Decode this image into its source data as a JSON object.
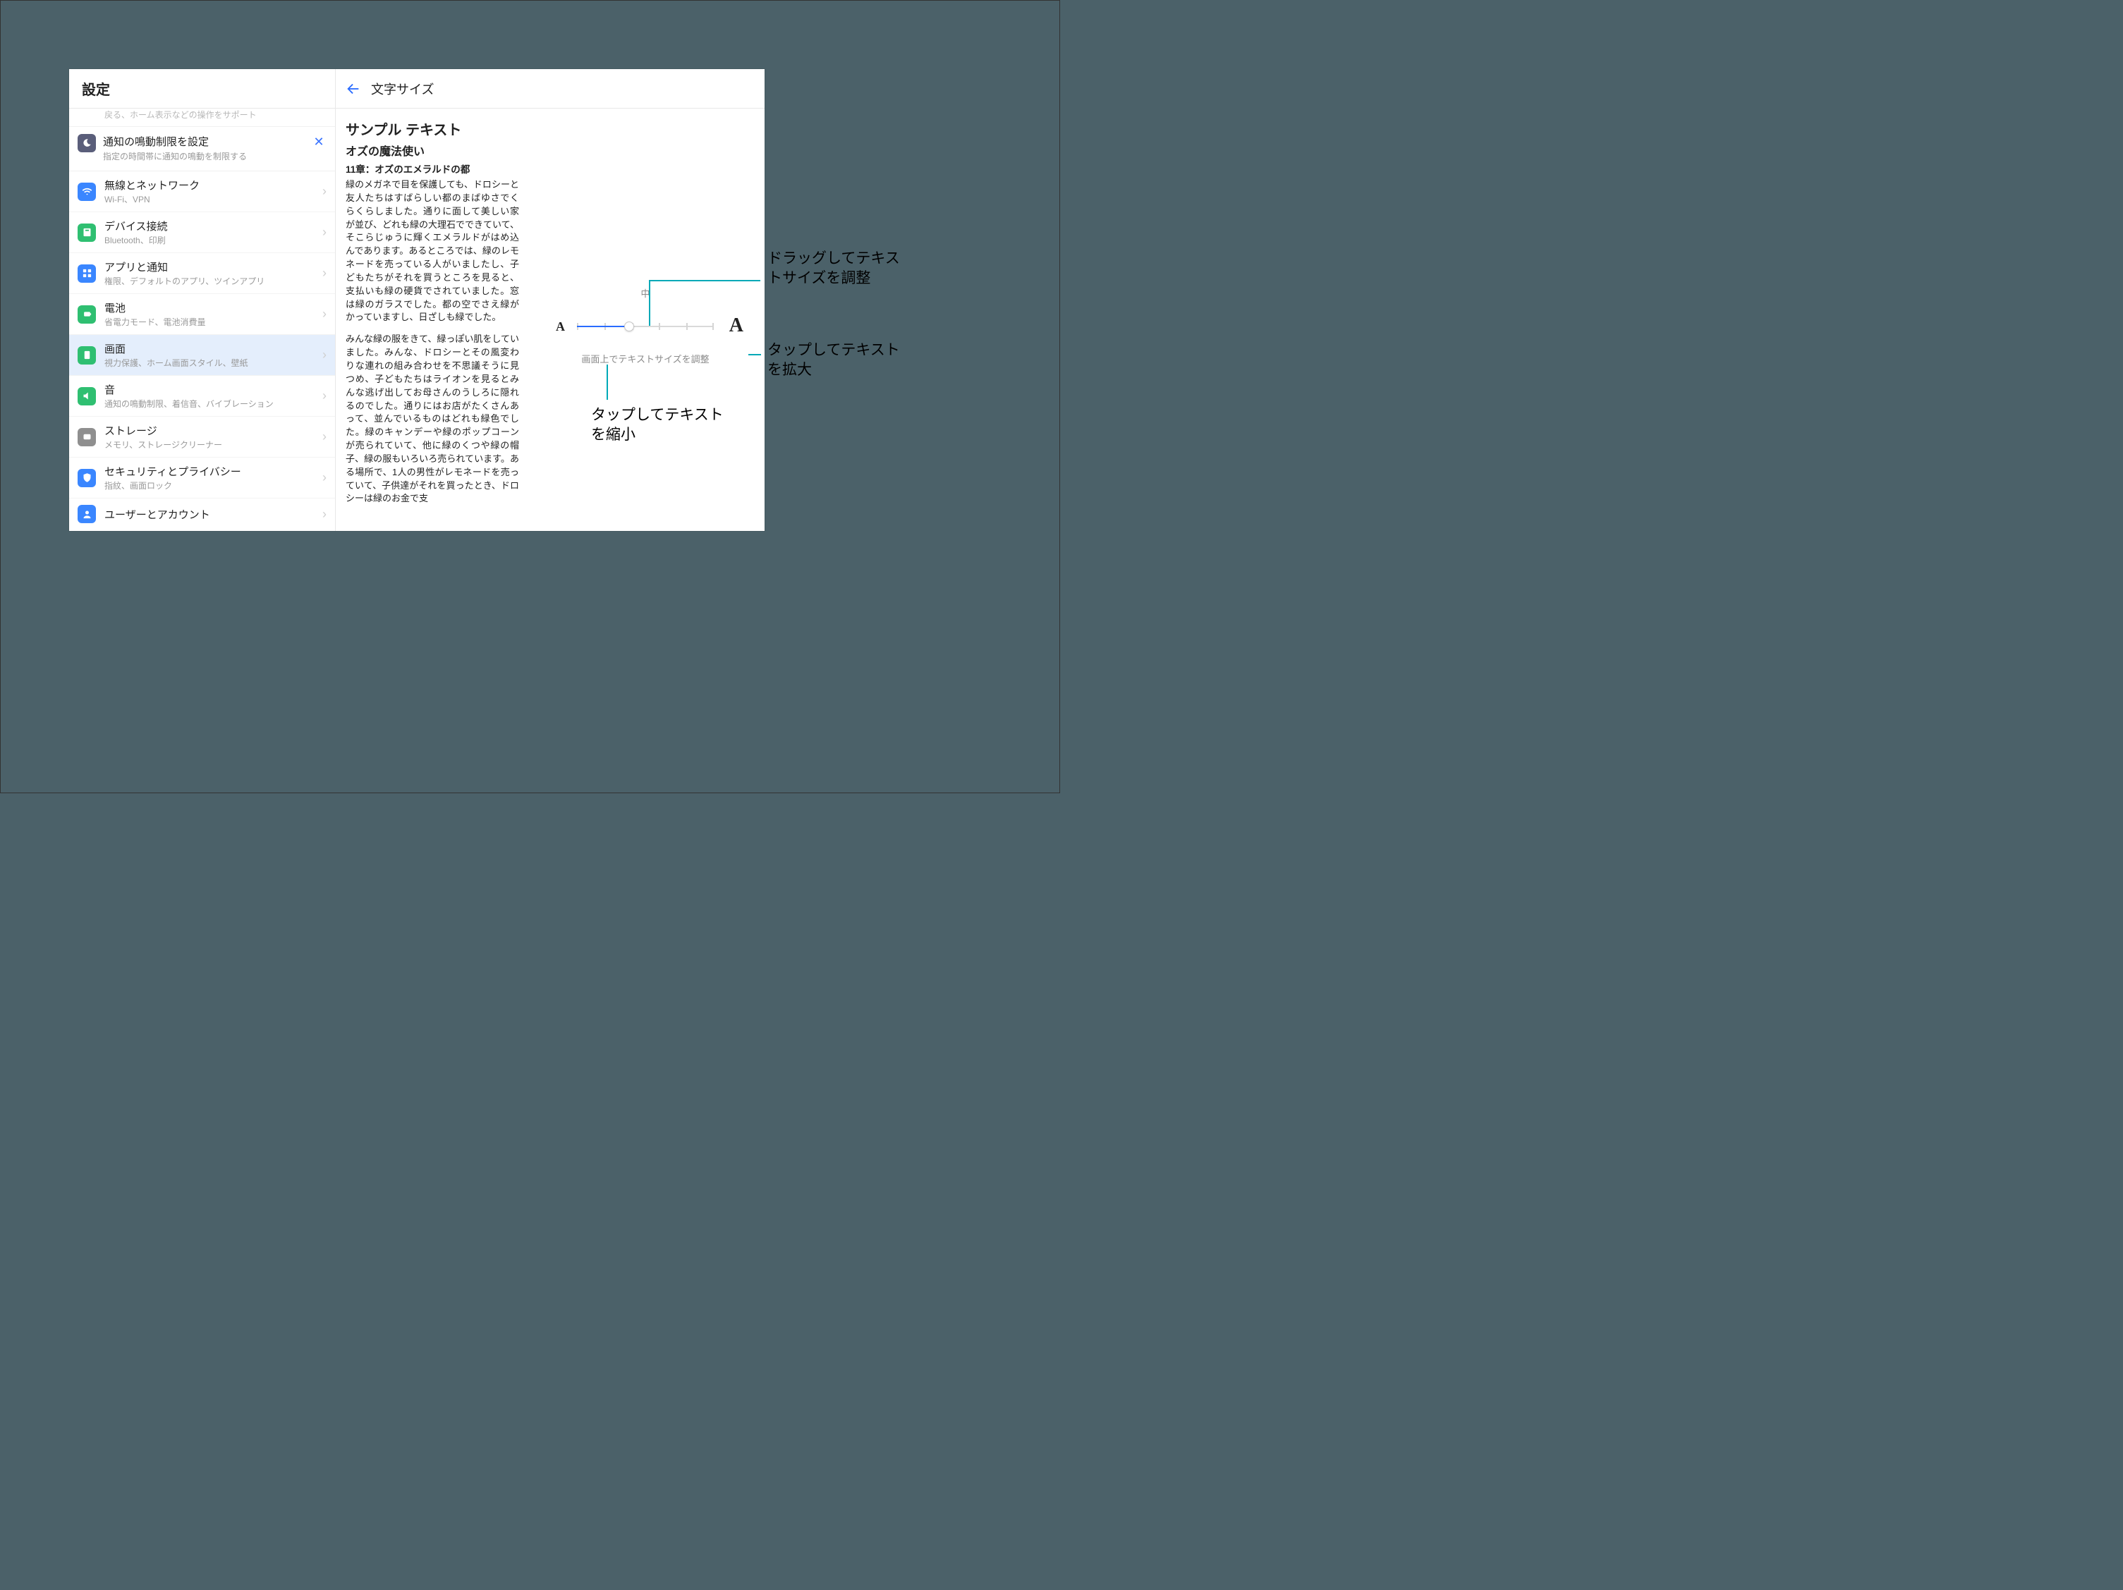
{
  "leftHeader": "設定",
  "truncated_prev_sub": "戻る、ホーム表示などの操作をサポート",
  "tip": {
    "title": "通知の鳴動制限を設定",
    "sub": "指定の時間帯に通知の鳴動を制限する"
  },
  "rows": {
    "wifi": {
      "title": "無線とネットワーク",
      "sub": "Wi-Fi、VPN"
    },
    "device": {
      "title": "デバイス接続",
      "sub": "Bluetooth、印刷"
    },
    "apps": {
      "title": "アプリと通知",
      "sub": "権限、デフォルトのアプリ、ツインアプリ"
    },
    "battery": {
      "title": "電池",
      "sub": "省電力モード、電池消費量"
    },
    "display": {
      "title": "画面",
      "sub": "視力保護、ホーム画面スタイル、壁紙"
    },
    "sound": {
      "title": "音",
      "sub": "通知の鳴動制限、着信音、バイブレーション"
    },
    "storage": {
      "title": "ストレージ",
      "sub": "メモリ、ストレージクリーナー"
    },
    "security": {
      "title": "セキュリティとプライバシー",
      "sub": "指紋、画面ロック"
    },
    "users": {
      "title": "ユーザーとアカウント",
      "sub": ""
    }
  },
  "rightTitle": "文字サイズ",
  "sample": {
    "heading": "サンプル テキスト",
    "sub": "オズの魔法使い",
    "chapter": "11章：オズのエメラルドの都",
    "para1": "緑のメガネで目を保護しても、ドロシーと友人たちはすばらしい都のまばゆさでくらくらしました。通りに面して美しい家が並び、どれも緑の大理石でできていて、そこらじゅうに輝くエメラルドがはめ込んであります。あるところでは、緑のレモネードを売っている人がいましたし、子どもたちがそれを買うところを見ると、支払いも緑の硬貨でされていました。窓は緑のガラスでした。都の空でさえ緑がかっていますし、日ざしも緑でした。",
    "para2": "みんな緑の服をきて、緑っぽい肌をしていました。みんな、ドロシーとその風変わりな連れの組み合わせを不思議そうに見つめ、子どもたちはライオンを見るとみんな逃げ出してお母さんのうしろに隠れるのでした。通りにはお店がたくさんあって、並んでいるものはどれも緑色でした。緑のキャンデーや緑のポップコーンが売られていて、他に緑のくつや緑の帽子、緑の服もいろいろ売られています。ある場所で、1人の男性がレモネードを売っていて、子供達がそれを買ったとき、ドロシーは緑のお金で支"
  },
  "slider": {
    "midLabel": "中",
    "smallA": "A",
    "largeA": "A",
    "caption": "画面上でテキストサイズを調整"
  },
  "callouts": {
    "drag": "ドラッグしてテキストサイズを調整",
    "large": "タップしてテキストを拡大",
    "small": "タップしてテキストを縮小"
  }
}
